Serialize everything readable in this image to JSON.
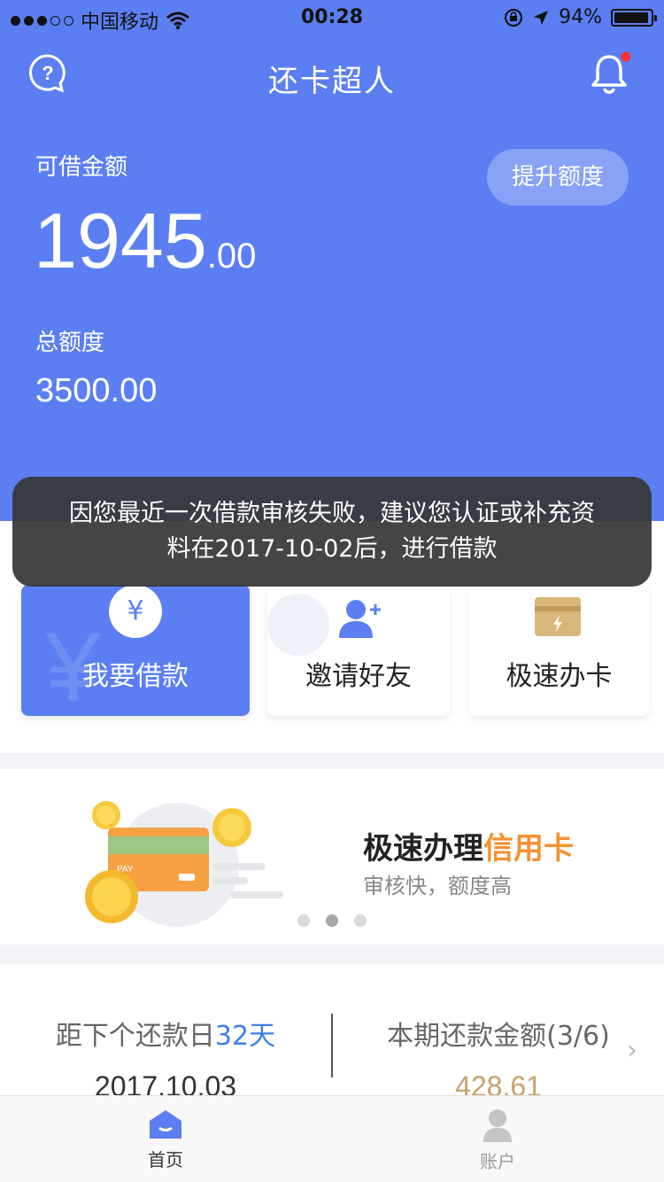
{
  "status_bar": {
    "carrier": "中国移动",
    "time": "00:28",
    "battery": "94%",
    "battery_level": 0.94,
    "signal_strength": 3,
    "signal_max": 5
  },
  "nav": {
    "title": "还卡超人",
    "help_icon": "help-bubble-icon",
    "bell_icon": "bell-icon",
    "bell_badge_color": "#ff2d2d"
  },
  "hero": {
    "available_label": "可借金额",
    "amount_int": "1945",
    "amount_dec": ".00",
    "raise_button": "提升额度",
    "total_label": "总额度",
    "total_value": "3500.00",
    "accent_color": "#5b7ff2"
  },
  "toast": {
    "line1": "因您最近一次借款审核失败，建议您认证或补充资",
    "line2": "料在2017-10-02后，进行借款"
  },
  "actions": [
    {
      "label": "我要借款",
      "icon": "yen-icon"
    },
    {
      "label": "邀请好友",
      "icon": "add-user-icon"
    },
    {
      "label": "极速办卡",
      "icon": "card-icon"
    }
  ],
  "banner": {
    "title_prefix": "极速办理",
    "title_highlight": "信用卡",
    "subtitle": "审核快，额度高",
    "card_text": "PAY",
    "pages": 3,
    "active_page": 2
  },
  "repayment": {
    "countdown_prefix": "距下个还款日",
    "countdown_days": "32天",
    "due_date": "2017.10.03",
    "amount_label": "本期还款金额(3/6)",
    "amount_value": "428.61"
  },
  "tabbar": {
    "home_label": "首页",
    "account_label": "账户"
  }
}
